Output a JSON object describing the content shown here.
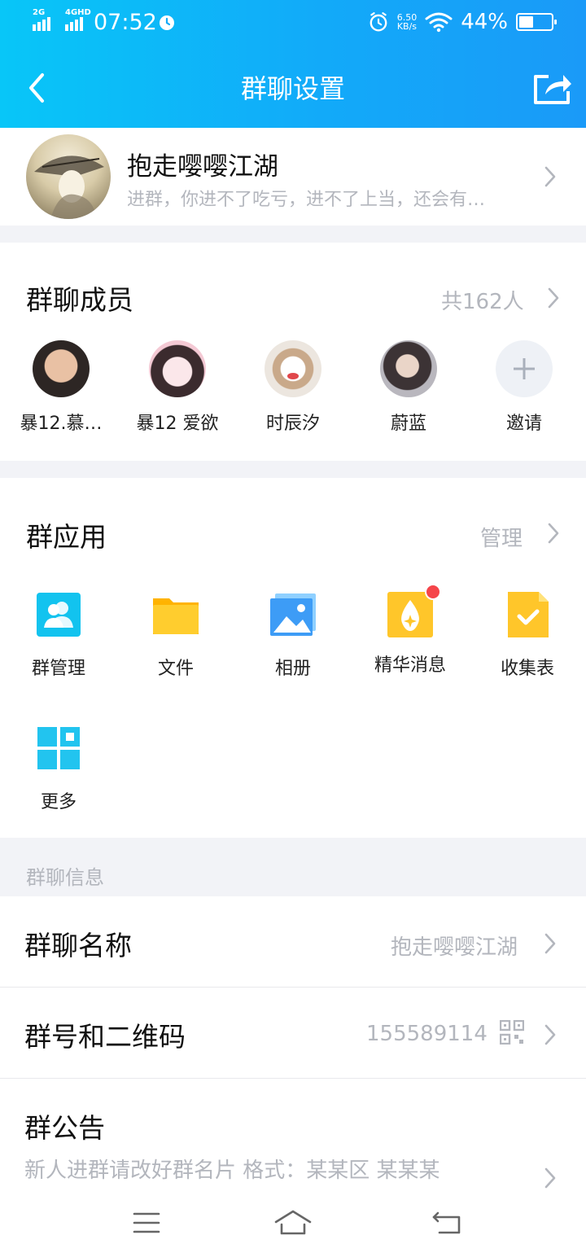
{
  "status_bar": {
    "net1": "2G",
    "net2": "4GHD",
    "time": "07:52",
    "speed_value": "6.50",
    "speed_unit": "KB/s",
    "battery_text": "44%",
    "battery_level": 0.44,
    "icons": [
      "signal-icon",
      "alarm-icon",
      "wifi-icon",
      "battery-icon"
    ]
  },
  "header": {
    "title": "群聊设置",
    "back_icon": "chevron-left-icon",
    "share_icon": "share-icon"
  },
  "profile": {
    "name": "抱走嘤嘤江湖",
    "description": "进群，你进不了吃亏，进不了上当，还会有…"
  },
  "members": {
    "title": "群聊成员",
    "count": "共162人",
    "list": [
      {
        "name": "暴12.慕…",
        "avatar_color": "#3a3330"
      },
      {
        "name": "暴12 爱欲",
        "avatar_color": "#f1d6df"
      },
      {
        "name": "时辰汐",
        "avatar_color": "#efe8e2"
      },
      {
        "name": "蔚蓝",
        "avatar_color": "#5a5255"
      }
    ],
    "invite_label": "邀请"
  },
  "apps": {
    "title": "群应用",
    "manage": "管理",
    "items": [
      {
        "label": "群管理",
        "icon": "group-manage-icon",
        "color": "#12c3ef"
      },
      {
        "label": "文件",
        "icon": "folder-icon",
        "color": "#ffc107"
      },
      {
        "label": "相册",
        "icon": "album-icon",
        "color": "#3d9cf6"
      },
      {
        "label": "精华消息",
        "icon": "essence-icon",
        "color": "#ffc62a"
      },
      {
        "label": "收集表",
        "icon": "form-icon",
        "color": "#ffc62a"
      },
      {
        "label": "更多",
        "icon": "more-grid-icon",
        "color": "#22c4ef"
      }
    ]
  },
  "group_info": {
    "section": "群聊信息",
    "name_label": "群聊名称",
    "name_value": "抱走嘤嘤江湖",
    "id_label": "群号和二维码",
    "id_value": "155589114",
    "notice_label": "群公告",
    "notice_value": "新人进群请改好群名片 格式：某某区 某某某"
  },
  "nav": {
    "icons": [
      "menu-icon",
      "home-icon",
      "back-icon"
    ]
  }
}
